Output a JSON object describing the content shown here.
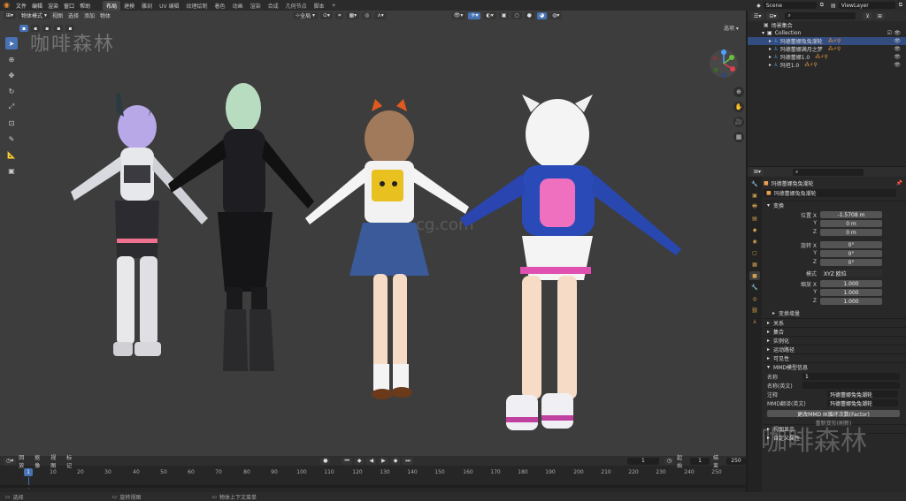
{
  "menu": [
    "文件",
    "编辑",
    "渲染",
    "窗口",
    "帮助"
  ],
  "workspaces": [
    "布局",
    "建模",
    "雕刻",
    "UV 编辑",
    "纹理绘制",
    "着色",
    "动画",
    "渲染",
    "合成",
    "几何节点",
    "脚本"
  ],
  "active_workspace": "布局",
  "scene": "Scene",
  "view_layer": "ViewLayer",
  "viewport": {
    "mode": "物体模式",
    "menus": [
      "视图",
      "选择",
      "添加",
      "物体"
    ],
    "transform": "全局",
    "options": "选项",
    "watermark": "咖啡森林",
    "center_watermark": "cg.com"
  },
  "tools": [
    "select",
    "cursor",
    "move",
    "rotate",
    "scale",
    "transform",
    "annotate",
    "measure",
    "add-cube"
  ],
  "outliner": {
    "root": "场景集合",
    "collection": "Collection",
    "objects": [
      {
        "name": "玛德蕾娜兔兔潮轮",
        "selected": true
      },
      {
        "name": "玛德蕾娜满月之梦",
        "selected": false
      },
      {
        "name": "玛德蕾娜1.0",
        "selected": false
      },
      {
        "name": "玛坦1.0",
        "selected": false
      }
    ]
  },
  "properties": {
    "object_name": "玛德蕾娜兔兔潮轮",
    "object_field": "玛德蕾娜兔兔潮轮",
    "transform_title": "变换",
    "location_label": "位置 X",
    "location": [
      "-1.5708 m",
      "0 m",
      "0 m"
    ],
    "rotation_label": "旋转 X",
    "rotation": [
      "0°",
      "0°",
      "0°"
    ],
    "mode_label": "模式",
    "mode_value": "XYZ 欧拉",
    "scale_label": "缩放 X",
    "scale": [
      "1.000",
      "1.000",
      "1.000"
    ],
    "axis_y": "Y",
    "axis_z": "Z",
    "delta": "变换增量",
    "sections": [
      "关系",
      "集合",
      "实例化",
      "运动路径",
      "可见性"
    ],
    "mmd_title": "MMD模型信息",
    "mmd_name_label": "名称",
    "mmd_name_value": "1",
    "mmd_name_en_label": "名称(英文)",
    "mmd_comment_label": "注释",
    "mmd_comment_value": "玛德蕾娜兔兔潮轮",
    "mmd_comment_en_label": "MMD翻译(英文)",
    "mmd_comment_en_value": "玛德蕾娜兔兔潮轮",
    "mmd_button": "更改MMD IK循环次数(Factor)",
    "mmd_button2": "重新变形(刷新)",
    "bottom_sections": [
      "视图显示",
      "自定义属性"
    ],
    "watermark": "咖啡森林"
  },
  "timeline": {
    "menus": [
      "回放",
      "抠像",
      "视图",
      "标记"
    ],
    "current_frame": "1",
    "start_label": "起始",
    "start": "1",
    "end_label": "结束",
    "end": "250",
    "ticks": [
      "1",
      "10",
      "20",
      "30",
      "40",
      "50",
      "60",
      "70",
      "80",
      "90",
      "100",
      "110",
      "120",
      "130",
      "140",
      "150",
      "160",
      "170",
      "180",
      "190",
      "200",
      "210",
      "220",
      "230",
      "240",
      "250"
    ]
  },
  "status": [
    "选择",
    "旋转视图",
    "物体上下文菜单"
  ],
  "colors": {
    "accent": "#4772b3",
    "viewport_bg": "#3d3d3d",
    "panel_bg": "#282828",
    "selected_row": "#334d80"
  }
}
